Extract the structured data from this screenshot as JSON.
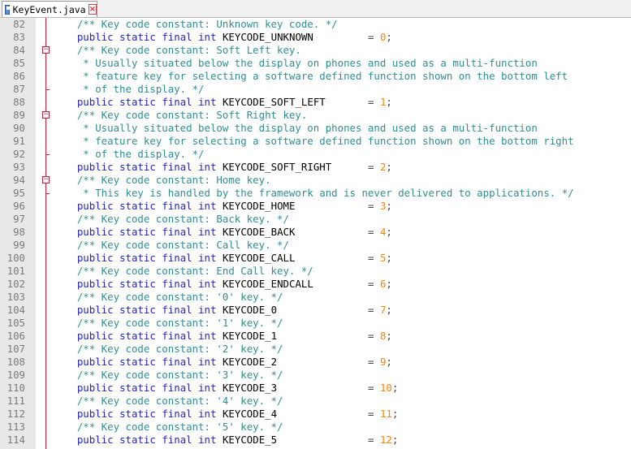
{
  "tab": {
    "filename": "KeyEvent.java",
    "icon": "file-save-icon",
    "close_icon": "close-icon",
    "close_glyph": "×"
  },
  "colors": {
    "comment": "#2f8f8f",
    "keyword": "#2222cc",
    "number": "#ff8000",
    "fold": "#c0203a",
    "gutter": "#e8e8e8"
  },
  "lines": [
    {
      "n": "82",
      "fold": "none",
      "code": "    /** Key code constant: Unknown key code. */"
    },
    {
      "n": "83",
      "fold": "none",
      "code": "    public static final int KEYCODE_UNKNOWN         = 0;"
    },
    {
      "n": "84",
      "fold": "start",
      "code": "    /** Key code constant: Soft Left key."
    },
    {
      "n": "85",
      "fold": "none",
      "code": "     * Usually situated below the display on phones and used as a multi-function"
    },
    {
      "n": "86",
      "fold": "none",
      "code": "     * feature key for selecting a software defined function shown on the bottom left"
    },
    {
      "n": "87",
      "fold": "end",
      "code": "     * of the display. */"
    },
    {
      "n": "88",
      "fold": "none",
      "code": "    public static final int KEYCODE_SOFT_LEFT       = 1;"
    },
    {
      "n": "89",
      "fold": "start",
      "code": "    /** Key code constant: Soft Right key."
    },
    {
      "n": "90",
      "fold": "none",
      "code": "     * Usually situated below the display on phones and used as a multi-function"
    },
    {
      "n": "91",
      "fold": "none",
      "code": "     * feature key for selecting a software defined function shown on the bottom right"
    },
    {
      "n": "92",
      "fold": "end",
      "code": "     * of the display. */"
    },
    {
      "n": "93",
      "fold": "none",
      "code": "    public static final int KEYCODE_SOFT_RIGHT      = 2;"
    },
    {
      "n": "94",
      "fold": "start",
      "code": "    /** Key code constant: Home key."
    },
    {
      "n": "95",
      "fold": "end",
      "code": "     * This key is handled by the framework and is never delivered to applications. */"
    },
    {
      "n": "96",
      "fold": "none",
      "code": "    public static final int KEYCODE_HOME            = 3;"
    },
    {
      "n": "97",
      "fold": "none",
      "code": "    /** Key code constant: Back key. */"
    },
    {
      "n": "98",
      "fold": "none",
      "code": "    public static final int KEYCODE_BACK            = 4;"
    },
    {
      "n": "99",
      "fold": "none",
      "code": "    /** Key code constant: Call key. */"
    },
    {
      "n": "100",
      "fold": "none",
      "code": "    public static final int KEYCODE_CALL            = 5;"
    },
    {
      "n": "101",
      "fold": "none",
      "code": "    /** Key code constant: End Call key. */"
    },
    {
      "n": "102",
      "fold": "none",
      "code": "    public static final int KEYCODE_ENDCALL         = 6;"
    },
    {
      "n": "103",
      "fold": "none",
      "code": "    /** Key code constant: '0' key. */"
    },
    {
      "n": "104",
      "fold": "none",
      "code": "    public static final int KEYCODE_0               = 7;"
    },
    {
      "n": "105",
      "fold": "none",
      "code": "    /** Key code constant: '1' key. */"
    },
    {
      "n": "106",
      "fold": "none",
      "code": "    public static final int KEYCODE_1               = 8;"
    },
    {
      "n": "107",
      "fold": "none",
      "code": "    /** Key code constant: '2' key. */"
    },
    {
      "n": "108",
      "fold": "none",
      "code": "    public static final int KEYCODE_2               = 9;"
    },
    {
      "n": "109",
      "fold": "none",
      "code": "    /** Key code constant: '3' key. */"
    },
    {
      "n": "110",
      "fold": "none",
      "code": "    public static final int KEYCODE_3               = 10;"
    },
    {
      "n": "111",
      "fold": "none",
      "code": "    /** Key code constant: '4' key. */"
    },
    {
      "n": "112",
      "fold": "none",
      "code": "    public static final int KEYCODE_4               = 11;"
    },
    {
      "n": "113",
      "fold": "none",
      "code": "    /** Key code constant: '5' key. */"
    },
    {
      "n": "114",
      "fold": "none",
      "code": "    public static final int KEYCODE_5               = 12;"
    }
  ]
}
